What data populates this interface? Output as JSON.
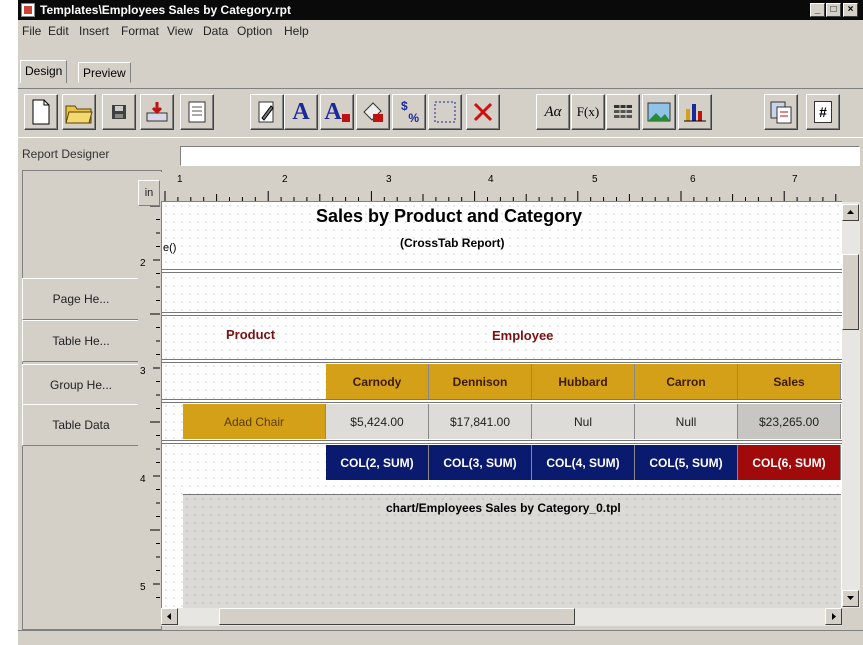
{
  "window": {
    "title": "Templates\\Employees Sales by Category.rpt"
  },
  "menu": [
    "File",
    "Edit",
    "Insert",
    "Format",
    "View",
    "Data",
    "Option",
    "Help"
  ],
  "tabs": [
    "Design",
    "Preview"
  ],
  "toolbar": {
    "icons": [
      "new-file",
      "open-folder",
      "save",
      "import",
      "properties",
      "edit",
      "font",
      "font-color",
      "fill-color",
      "number-format",
      "border",
      "delete",
      "text-object",
      "formula",
      "table",
      "image",
      "chart",
      "page-setup",
      "page-number"
    ],
    "text_glyphs": {
      "font": "A",
      "font_color": "A",
      "text_object": "Aα",
      "formula": "F(x)",
      "number_format_top": "$",
      "number_format_bottom": "%",
      "page_number": "#"
    }
  },
  "designer": {
    "label": "Report Designer",
    "value": ""
  },
  "sections": [
    "Page He...",
    "Table He...",
    "Group He...",
    "Table Data"
  ],
  "ruler": {
    "unit": "in",
    "horizontal": [
      "1",
      "2",
      "3",
      "4",
      "5",
      "6",
      "7"
    ],
    "vertical": [
      "2",
      "3",
      "4",
      "5"
    ]
  },
  "report": {
    "title": "Sales by Product and Category",
    "subtitle": "(CrossTab Report)",
    "clipped_field": "e()",
    "product_label": "Product",
    "employee_label": "Employee",
    "headers": [
      "Carnody",
      "Dennison",
      "Hubbard",
      "Carron",
      "Sales"
    ],
    "row_label": "Adad Chair",
    "values": [
      "$5,424.00",
      "$17,841.00",
      "Nul",
      "Null",
      "$23,265.00"
    ],
    "sums": [
      "COL(2, SUM)",
      "COL(3, SUM)",
      "COL(4, SUM)",
      "COL(5, SUM)",
      "COL(6, SUM)"
    ],
    "chart_caption": "chart/Employees Sales by Category_0.tpl"
  },
  "colors": {
    "header": "#d4a017",
    "sum": "#0a1a6e",
    "sum_total": "#a10a0a",
    "data": "#dedcd8"
  }
}
